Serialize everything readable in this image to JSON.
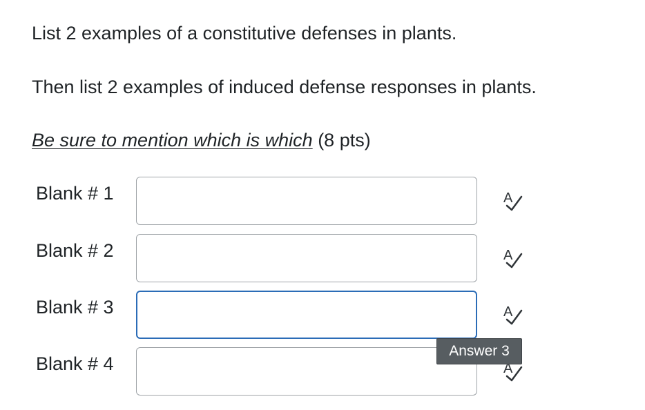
{
  "question": {
    "line1": "List 2 examples of a constitutive defenses in plants.",
    "line2": "Then list 2 examples of induced defense responses in plants.",
    "line3_emphasis": "Be sure to mention which is which",
    "line3_suffix": " (8 pts)"
  },
  "blanks": [
    {
      "label": "Blank # 1",
      "value": "",
      "icon": "spell-check-icon"
    },
    {
      "label": "Blank # 2",
      "value": "",
      "icon": "spell-check-icon"
    },
    {
      "label": "Blank # 3",
      "value": "",
      "icon": "spell-check-icon",
      "focused": true
    },
    {
      "label": "Blank # 4",
      "value": "",
      "icon": "spell-check-icon"
    }
  ],
  "tooltip": {
    "text": "Answer 3"
  },
  "colors": {
    "focus_border": "#2b6cb7",
    "input_border": "#9ea3a7",
    "tooltip_bg": "#575d61"
  }
}
